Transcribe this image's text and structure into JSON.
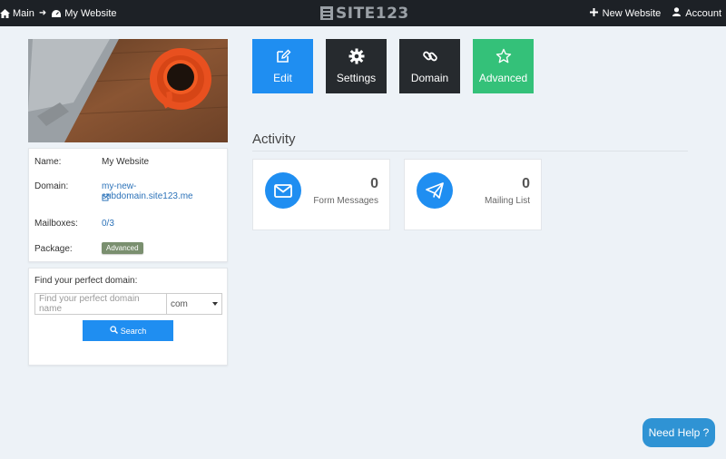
{
  "topbar": {
    "breadcrumb": {
      "main": "Main",
      "site": "My Website"
    },
    "logo_text": "SITE123",
    "new_website": "New Website",
    "account": "Account"
  },
  "info": {
    "name_label": "Name:",
    "name_value": "My Website",
    "domain_label": "Domain:",
    "domain_value": "my-new-subdomain.site123.me",
    "mailboxes_label": "Mailboxes:",
    "mailboxes_value": "0/3",
    "package_label": "Package:",
    "package_value": "Advanced"
  },
  "domain_search": {
    "label": "Find your perfect domain:",
    "placeholder": "Find your perfect domain name",
    "tld": "com",
    "button": "Search"
  },
  "tiles": [
    {
      "label": "Edit",
      "icon": "edit-icon",
      "color": "#1f8ef1"
    },
    {
      "label": "Settings",
      "icon": "gear-icon",
      "color": "#262a2e"
    },
    {
      "label": "Domain",
      "icon": "link-icon",
      "color": "#262a2e"
    },
    {
      "label": "Advanced",
      "icon": "star-icon",
      "color": "#34c179"
    }
  ],
  "activity": {
    "title": "Activity",
    "stats": [
      {
        "count": "0",
        "label": "Form Messages",
        "icon": "envelope-icon"
      },
      {
        "count": "0",
        "label": "Mailing List",
        "icon": "paper-plane-icon"
      }
    ]
  },
  "help_button": "Need Help ?",
  "colors": {
    "primary": "#1f8ef1",
    "dark": "#1d2126",
    "success": "#34c179"
  }
}
